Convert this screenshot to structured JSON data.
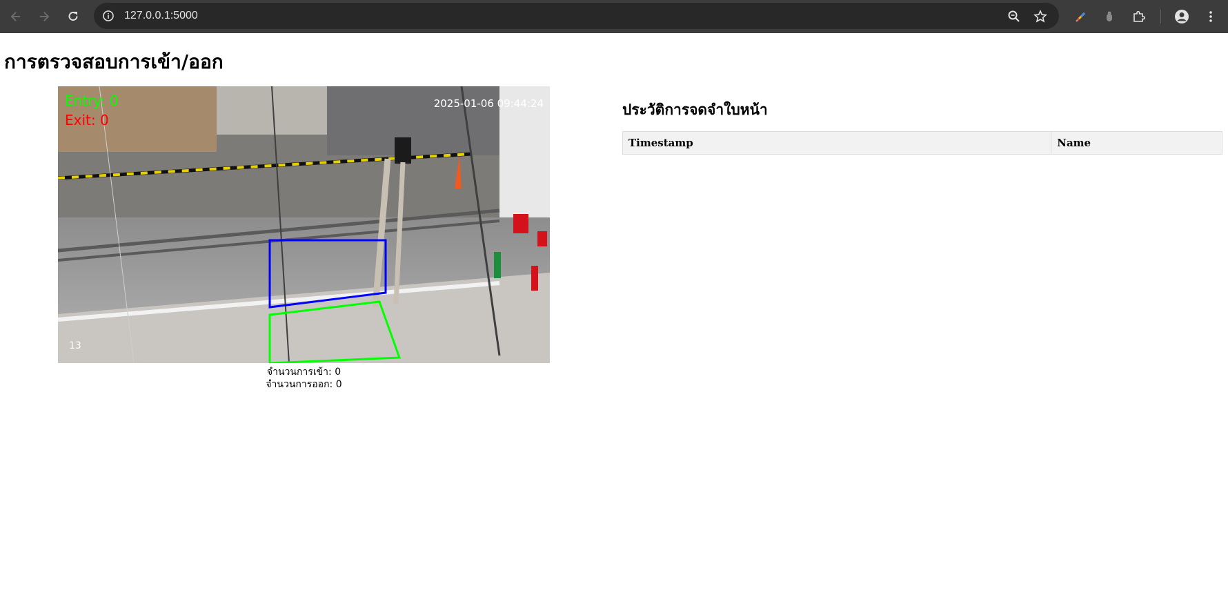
{
  "browser": {
    "url": "127.0.0.1:5000",
    "icons": [
      "back-arrow-icon",
      "forward-arrow-icon",
      "reload-icon",
      "site-info-icon",
      "zoom-icon",
      "bookmark-star-icon",
      "color-pen-extension-icon",
      "grey-extension-icon",
      "extensions-puzzle-icon",
      "profile-avatar-icon",
      "more-menu-icon"
    ]
  },
  "page": {
    "title": "การตรวจสอบการเข้า/ออก"
  },
  "video": {
    "entry_overlay": "Entry: 0",
    "exit_overlay": "Exit: 0",
    "timestamp_overlay": "2025-01-06 09:44:24",
    "corner_number": "13",
    "colors": {
      "entry": "#00ff00",
      "exit": "#ff0000",
      "upper_zone": "#0000ff",
      "lower_zone": "#00ff00"
    }
  },
  "counts": {
    "entry_label": "จำนวนการเข้า: 0",
    "exit_label": "จำนวนการออก: 0"
  },
  "history": {
    "title": "ประวัติการจดจำใบหน้า",
    "columns": [
      "Timestamp",
      "Name"
    ],
    "rows": []
  }
}
